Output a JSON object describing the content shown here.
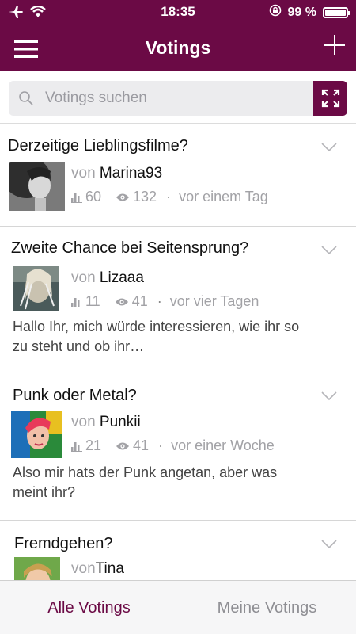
{
  "status_bar": {
    "time": "18:35",
    "battery": "99 %",
    "battery_level": 0.99
  },
  "header": {
    "title": "Votings"
  },
  "search": {
    "placeholder": "Votings suchen"
  },
  "votings": [
    {
      "title": "Derzeitige Lieblingsfilme?",
      "by": "von",
      "author": "Marina93",
      "votes": "60",
      "views": "132",
      "sep": "·",
      "time": "vor einem Tag",
      "excerpt": ""
    },
    {
      "title": "Zweite Chance bei Seitensprung?",
      "by": "von",
      "author": "Lizaaa",
      "votes": "11",
      "views": "41",
      "sep": "·",
      "time": "vor vier Tagen",
      "excerpt": "Hallo Ihr, mich würde interessieren, wie ihr so zu steht und ob ihr…"
    },
    {
      "title": "Punk oder Metal?",
      "by": "von",
      "author": "Punkii",
      "votes": "21",
      "views": "41",
      "sep": "·",
      "time": "vor einer Woche",
      "excerpt": "Also mir hats der Punk angetan, aber was meint ihr?"
    },
    {
      "title": "Fremdgehen?",
      "by": "von",
      "author": "Tina",
      "votes": "",
      "views": "",
      "sep": "",
      "time": "",
      "excerpt": ""
    }
  ],
  "tabs": {
    "all": "Alle Votings",
    "mine": "Meine Votings"
  },
  "colors": {
    "brand": "#6b0a45",
    "muted": "#a2a2a6"
  }
}
